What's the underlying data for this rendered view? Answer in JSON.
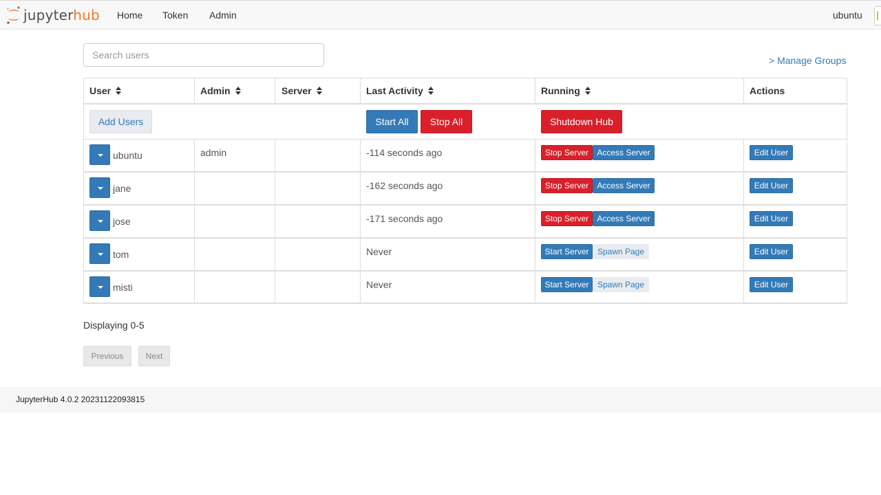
{
  "brand": {
    "part1": "jupyter",
    "part2": "hub",
    "logo_icon": "jupyter-logo-icon"
  },
  "nav": {
    "links": [
      "Home",
      "Token",
      "Admin"
    ],
    "user": "ubuntu"
  },
  "search": {
    "placeholder": "Search users",
    "value": ""
  },
  "manage_groups": "> Manage Groups",
  "table": {
    "columns": [
      "User",
      "Admin",
      "Server",
      "Last Activity",
      "Running",
      "Actions"
    ],
    "sortable_icon": "sort-icon",
    "bulk": {
      "add_users": "Add Users",
      "start_all": "Start All",
      "stop_all": "Stop All",
      "shutdown_hub": "Shutdown Hub"
    },
    "rows": [
      {
        "user": "ubuntu",
        "admin": "admin",
        "server": "",
        "last_activity": "-114 seconds ago",
        "running": true,
        "primary": "Stop Server",
        "secondary": "Access Server",
        "action": "Edit User"
      },
      {
        "user": "jane",
        "admin": "",
        "server": "",
        "last_activity": "-162 seconds ago",
        "running": true,
        "primary": "Stop Server",
        "secondary": "Access Server",
        "action": "Edit User"
      },
      {
        "user": "jose",
        "admin": "",
        "server": "",
        "last_activity": "-171 seconds ago",
        "running": true,
        "primary": "Stop Server",
        "secondary": "Access Server",
        "action": "Edit User"
      },
      {
        "user": "tom",
        "admin": "",
        "server": "",
        "last_activity": "Never",
        "running": false,
        "primary": "Start Server",
        "secondary": "Spawn Page",
        "action": "Edit User"
      },
      {
        "user": "misti",
        "admin": "",
        "server": "",
        "last_activity": "Never",
        "running": false,
        "primary": "Start Server",
        "secondary": "Spawn Page",
        "action": "Edit User"
      }
    ]
  },
  "pagination": {
    "displaying": "Displaying 0-5",
    "previous": "Previous",
    "next": "Next"
  },
  "footer": {
    "version": "JupyterHub 4.0.2 20231122093815"
  },
  "colors": {
    "primary": "#337ab7",
    "danger": "#d9202a",
    "brand_orange": "#f37626"
  }
}
